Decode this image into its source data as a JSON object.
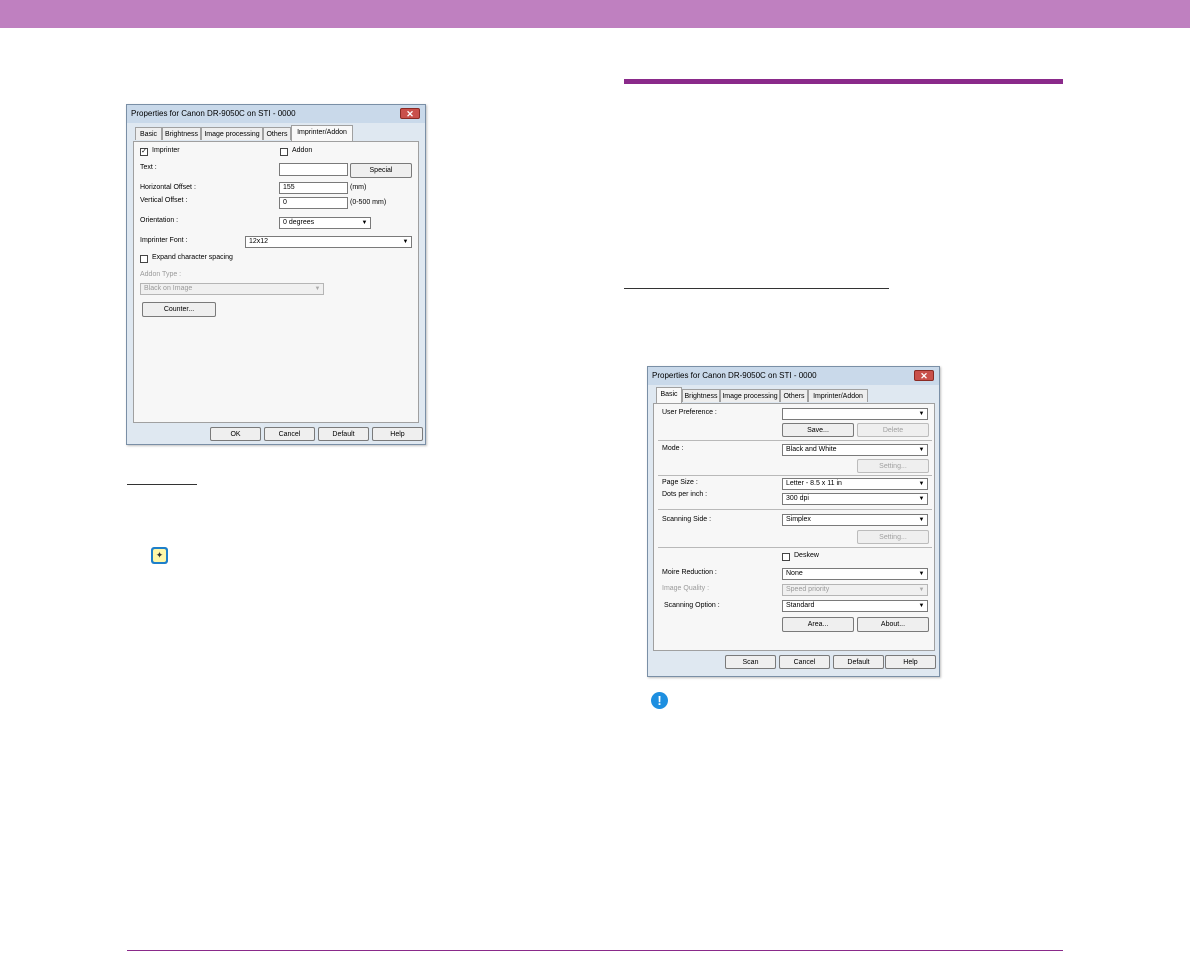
{
  "colors": {
    "band": "#bf80c0",
    "rule": "#8a2a8a"
  },
  "dialog1": {
    "title": "Properties for Canon DR-9050C on STI - 0000",
    "close": "✕",
    "tabs": [
      "Basic",
      "Brightness",
      "Image processing",
      "Others",
      "Imprinter/Addon"
    ],
    "imprinter_label": "Imprinter",
    "imprinter_checked": "✓",
    "addon_label": "Addon",
    "text_label": "Text :",
    "text_value": "",
    "special_button": "Special",
    "h_offset_label": "Horizontal Offset :",
    "h_offset_value": "155",
    "h_offset_unit": "(mm)",
    "v_offset_label": "Vertical Offset :",
    "v_offset_value": "0",
    "v_offset_range": "(0-500 mm)",
    "orientation_label": "Orientation :",
    "orientation_value": "0 degrees",
    "font_label": "Imprinter Font :",
    "font_value": "12x12",
    "expand_label": "Expand character spacing",
    "addon_type_label": "Addon Type :",
    "addon_type_value": "Black on Image",
    "counter_button": "Counter...",
    "ok": "OK",
    "cancel": "Cancel",
    "default": "Default",
    "help": "Help"
  },
  "dialog2": {
    "title": "Properties for Canon DR-9050C on STI - 0000",
    "close": "✕",
    "tabs": [
      "Basic",
      "Brightness",
      "Image processing",
      "Others",
      "Imprinter/Addon"
    ],
    "user_pref_label": "User Preference :",
    "user_pref_value": "",
    "save_button": "Save...",
    "delete_button": "Delete",
    "mode_label": "Mode :",
    "mode_value": "Black and White",
    "setting_button": "Setting...",
    "page_size_label": "Page Size :",
    "page_size_value": "Letter - 8.5 x 11 in",
    "dpi_label": "Dots per inch :",
    "dpi_value": "300 dpi",
    "side_label": "Scanning Side :",
    "side_value": "Simplex",
    "setting2_button": "Setting...",
    "deskew_label": "Deskew",
    "moire_label": "Moire Reduction :",
    "moire_value": "None",
    "quality_label": "Image Quality :",
    "quality_value": "Speed priority",
    "option_label": "Scanning Option :",
    "option_value": "Standard",
    "area_button": "Area...",
    "about_button": "About...",
    "scan": "Scan",
    "cancel": "Cancel",
    "default": "Default",
    "help": "Help"
  },
  "icons": {
    "tip": "tip-icon",
    "tip_glyph": "✦",
    "caution": "caution-icon",
    "caution_glyph": "!"
  }
}
